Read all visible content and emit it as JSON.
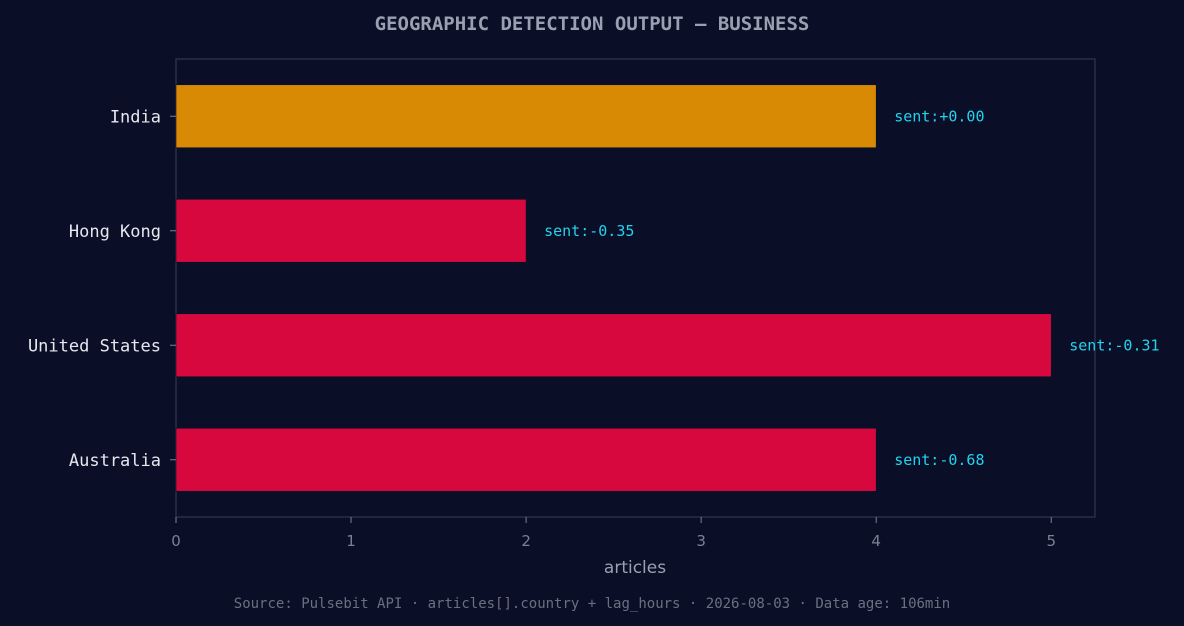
{
  "chart_data": {
    "type": "bar",
    "orientation": "horizontal",
    "title": "GEOGRAPHIC DETECTION OUTPUT — BUSINESS",
    "xlabel": "articles",
    "ylabel": "",
    "xlim": [
      0,
      5.25
    ],
    "xticks": [
      0,
      1,
      2,
      3,
      4,
      5
    ],
    "grid": false,
    "categories": [
      "India",
      "Hong Kong",
      "United States",
      "Australia"
    ],
    "values": [
      4,
      2,
      5,
      4
    ],
    "data_labels": [
      "sent:+0.00",
      "sent:-0.35",
      "sent:-0.31",
      "sent:-0.68"
    ],
    "bar_colors": [
      "#d98a04",
      "#d7083e",
      "#d7083e",
      "#d7083e"
    ],
    "data_label_color": "#22d3ee",
    "background_color": "#0a0e27",
    "frame_color": "#2a2e4a"
  },
  "footer": {
    "source": "Source: Pulsebit API · articles[].country + lag_hours · 2026-08-03 · Data age: 106min"
  }
}
